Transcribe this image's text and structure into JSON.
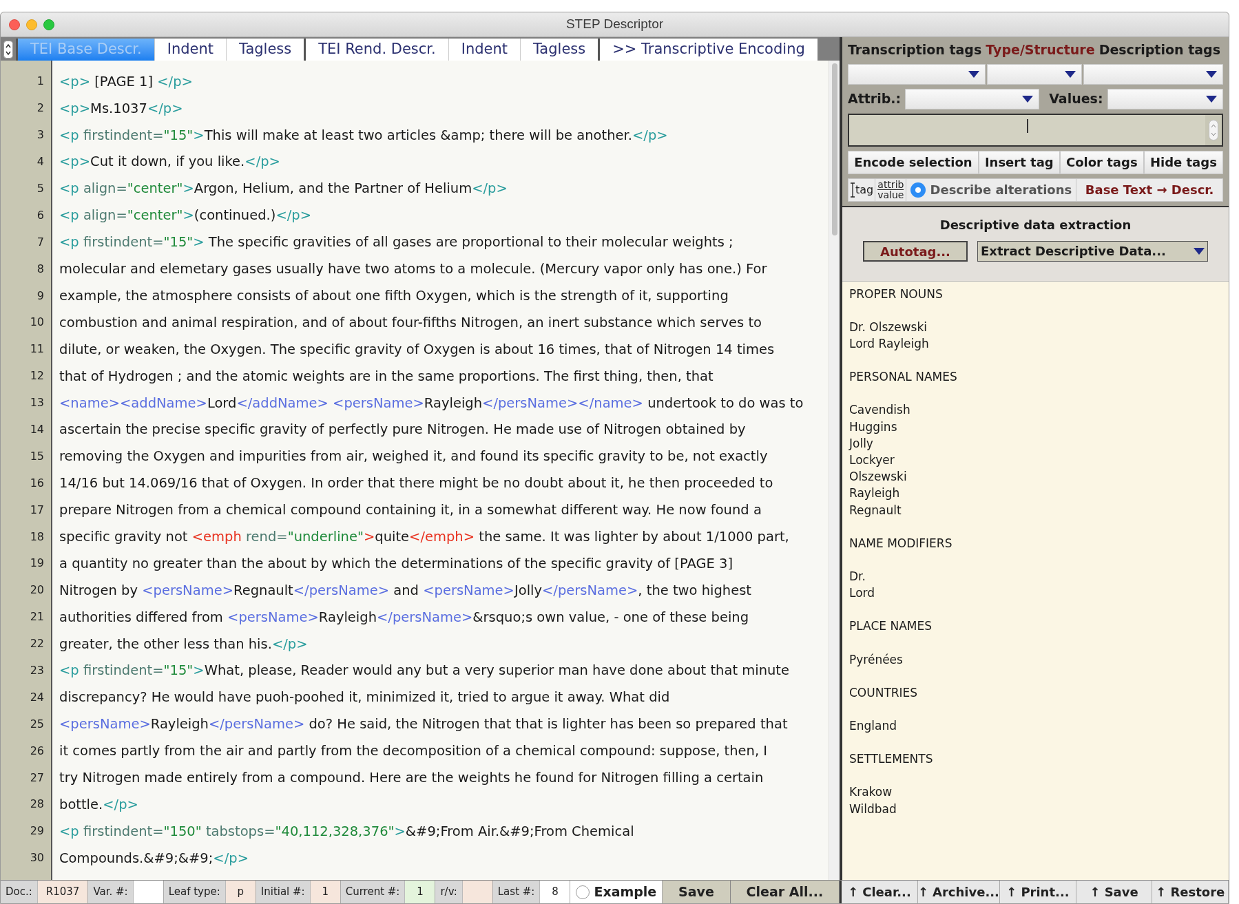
{
  "window": {
    "title": "STEP Descriptor"
  },
  "tabs": [
    {
      "label": "TEI Base Descr.",
      "selected": true,
      "group_start": true
    },
    {
      "label": "Indent",
      "selected": false,
      "group_start": false
    },
    {
      "label": "Tagless",
      "selected": false,
      "group_start": false
    },
    {
      "label": "TEI Rend. Descr.",
      "selected": false,
      "group_start": true
    },
    {
      "label": "Indent",
      "selected": false,
      "group_start": false
    },
    {
      "label": "Tagless",
      "selected": false,
      "group_start": false
    },
    {
      "label": ">> Transcriptive Encoding",
      "selected": false,
      "group_start": true
    }
  ],
  "editor": {
    "lines": [
      {
        "number": "1",
        "segments": [
          {
            "kind": "tag",
            "text": "<p>"
          },
          {
            "kind": "text",
            "text": " [PAGE 1] "
          },
          {
            "kind": "tag",
            "text": "</p>"
          }
        ]
      },
      {
        "number": "2",
        "segments": [
          {
            "kind": "tag",
            "text": "<p>"
          },
          {
            "kind": "text",
            "text": "Ms.1037"
          },
          {
            "kind": "tag",
            "text": "</p>"
          }
        ]
      },
      {
        "number": "3",
        "segments": [
          {
            "kind": "tag",
            "text": "<p "
          },
          {
            "kind": "attr",
            "text": "firstindent="
          },
          {
            "kind": "value",
            "text": "\"15\""
          },
          {
            "kind": "tag",
            "text": ">"
          },
          {
            "kind": "text",
            "text": "This will make at least two articles &amp; there will be another."
          },
          {
            "kind": "tag",
            "text": "</p>"
          }
        ]
      },
      {
        "number": "4",
        "segments": [
          {
            "kind": "tag",
            "text": "<p>"
          },
          {
            "kind": "text",
            "text": "Cut it down, if you like."
          },
          {
            "kind": "tag",
            "text": "</p>"
          }
        ]
      },
      {
        "number": "5",
        "segments": [
          {
            "kind": "tag",
            "text": "<p "
          },
          {
            "kind": "attr",
            "text": "align="
          },
          {
            "kind": "value",
            "text": "\"center\""
          },
          {
            "kind": "tag",
            "text": ">"
          },
          {
            "kind": "text",
            "text": "Argon, Helium, and the Partner of Helium"
          },
          {
            "kind": "tag",
            "text": "</p>"
          }
        ]
      },
      {
        "number": "6",
        "segments": [
          {
            "kind": "tag",
            "text": "<p "
          },
          {
            "kind": "attr",
            "text": "align="
          },
          {
            "kind": "value",
            "text": "\"center\""
          },
          {
            "kind": "tag",
            "text": ">"
          },
          {
            "kind": "text",
            "text": "(continued.)"
          },
          {
            "kind": "tag",
            "text": "</p>"
          }
        ]
      },
      {
        "number": "7",
        "segments": [
          {
            "kind": "tag",
            "text": "<p "
          },
          {
            "kind": "attr",
            "text": "firstindent="
          },
          {
            "kind": "value",
            "text": "\"15\""
          },
          {
            "kind": "tag",
            "text": ">"
          },
          {
            "kind": "text",
            "text": " The specific gravities of all gases are proportional to their molecular weights ;"
          }
        ]
      },
      {
        "number": "8",
        "segments": [
          {
            "kind": "text",
            "text": "molecular and elemetary gases usually have two atoms to a molecule. (Mercury vapor only has one.) For"
          }
        ]
      },
      {
        "number": "9",
        "segments": [
          {
            "kind": "text",
            "text": "example, the atmosphere consists of about one fifth Oxygen, which is the strength of it, supporting"
          }
        ]
      },
      {
        "number": "10",
        "segments": [
          {
            "kind": "text",
            "text": "combustion and animal respiration, and of about four-fifths Nitrogen, an inert substance which serves to"
          }
        ]
      },
      {
        "number": "11",
        "segments": [
          {
            "kind": "text",
            "text": "dilute, or weaken, the Oxygen. The specific gravity of Oxygen is about 16 times, that of Nitrogen 14 times"
          }
        ]
      },
      {
        "number": "12",
        "segments": [
          {
            "kind": "text",
            "text": "that of Hydrogen ; and the atomic weights are in the same proportions. The first thing, then, that"
          }
        ]
      },
      {
        "number": "13",
        "segments": [
          {
            "kind": "name",
            "text": "<name><addName>"
          },
          {
            "kind": "text",
            "text": "Lord"
          },
          {
            "kind": "name",
            "text": "</addName> <persName>"
          },
          {
            "kind": "text",
            "text": "Rayleigh"
          },
          {
            "kind": "name",
            "text": "</persName></name>"
          },
          {
            "kind": "text",
            "text": " undertook to do was to"
          }
        ]
      },
      {
        "number": "14",
        "segments": [
          {
            "kind": "text",
            "text": "ascertain the precise specific gravity of perfectly pure Nitrogen. He made use of Nitrogen obtained by"
          }
        ]
      },
      {
        "number": "15",
        "segments": [
          {
            "kind": "text",
            "text": "removing the Oxygen and impurities from air, weighed it, and found its specific gravity to be, not exactly"
          }
        ]
      },
      {
        "number": "16",
        "segments": [
          {
            "kind": "text",
            "text": "14/16 but 14.069/16 that of Oxygen. In order that there might be no doubt about it, he then proceeded to"
          }
        ]
      },
      {
        "number": "17",
        "segments": [
          {
            "kind": "text",
            "text": "prepare Nitrogen from a chemical compound containing it, in a somewhat different way. He now found a"
          }
        ]
      },
      {
        "number": "18",
        "segments": [
          {
            "kind": "text",
            "text": "specific gravity not "
          },
          {
            "kind": "emph",
            "text": "<emph "
          },
          {
            "kind": "attr",
            "text": "rend="
          },
          {
            "kind": "value",
            "text": "\"underline\""
          },
          {
            "kind": "emph",
            "text": ">"
          },
          {
            "kind": "text",
            "text": "quite"
          },
          {
            "kind": "emph",
            "text": "</emph>"
          },
          {
            "kind": "text",
            "text": " the same. It was lighter by about 1/1000 part,"
          }
        ]
      },
      {
        "number": "19",
        "segments": [
          {
            "kind": "text",
            "text": "a quantity no greater than the about by which the determinations of the specific gravity of [PAGE 3]"
          }
        ]
      },
      {
        "number": "20",
        "segments": [
          {
            "kind": "text",
            "text": "Nitrogen by "
          },
          {
            "kind": "name",
            "text": "<persName>"
          },
          {
            "kind": "text",
            "text": "Regnault"
          },
          {
            "kind": "name",
            "text": "</persName>"
          },
          {
            "kind": "text",
            "text": " and "
          },
          {
            "kind": "name",
            "text": "<persName>"
          },
          {
            "kind": "text",
            "text": "Jolly"
          },
          {
            "kind": "name",
            "text": "</persName>"
          },
          {
            "kind": "text",
            "text": ", the two highest"
          }
        ]
      },
      {
        "number": "21",
        "segments": [
          {
            "kind": "text",
            "text": "authorities differed from "
          },
          {
            "kind": "name",
            "text": "<persName>"
          },
          {
            "kind": "text",
            "text": "Rayleigh"
          },
          {
            "kind": "name",
            "text": "</persName>"
          },
          {
            "kind": "text",
            "text": "&rsquo;s own value, - one of these being"
          }
        ]
      },
      {
        "number": "22",
        "segments": [
          {
            "kind": "text",
            "text": "greater, the other less than his."
          },
          {
            "kind": "tag",
            "text": "</p>"
          }
        ]
      },
      {
        "number": "23",
        "segments": [
          {
            "kind": "tag",
            "text": "<p "
          },
          {
            "kind": "attr",
            "text": "firstindent="
          },
          {
            "kind": "value",
            "text": "\"15\""
          },
          {
            "kind": "tag",
            "text": ">"
          },
          {
            "kind": "text",
            "text": "What, please, Reader would any but a very superior man have done about that minute"
          }
        ]
      },
      {
        "number": "24",
        "segments": [
          {
            "kind": "text",
            "text": "discrepancy? He would have puoh-poohed it, minimized it, tried to argue it away. What did"
          }
        ]
      },
      {
        "number": "25",
        "segments": [
          {
            "kind": "name",
            "text": "<persName>"
          },
          {
            "kind": "text",
            "text": "Rayleigh"
          },
          {
            "kind": "name",
            "text": "</persName>"
          },
          {
            "kind": "text",
            "text": " do? He said, the Nitrogen that that is lighter has been so prepared that"
          }
        ]
      },
      {
        "number": "26",
        "segments": [
          {
            "kind": "text",
            "text": "it comes partly from the air and partly from the decomposition of a chemical compound: suppose, then, I"
          }
        ]
      },
      {
        "number": "27",
        "segments": [
          {
            "kind": "text",
            "text": "try Nitrogen made entirely from a compound. Here are the weights he found for Nitrogen filling a certain"
          }
        ]
      },
      {
        "number": "28",
        "segments": [
          {
            "kind": "text",
            "text": "bottle."
          },
          {
            "kind": "tag",
            "text": "</p>"
          }
        ]
      },
      {
        "number": "29",
        "segments": [
          {
            "kind": "tag",
            "text": "<p "
          },
          {
            "kind": "attr",
            "text": "firstindent="
          },
          {
            "kind": "value",
            "text": "\"150\""
          },
          {
            "kind": "attr",
            "text": " tabstops="
          },
          {
            "kind": "value",
            "text": "\"40,112,328,376\""
          },
          {
            "kind": "tag",
            "text": ">"
          },
          {
            "kind": "text",
            "text": "&#9;From Air.&#9;From Chemical"
          }
        ]
      },
      {
        "number": "30",
        "segments": [
          {
            "kind": "text",
            "text": "Compounds.&#9;&#9;"
          },
          {
            "kind": "tag",
            "text": "</p>"
          }
        ]
      }
    ]
  },
  "tag_panel": {
    "headers": [
      {
        "kind": "plain",
        "text": "Transcription tags"
      },
      {
        "kind": "accent",
        "text": "Type/Structure"
      },
      {
        "kind": "plain",
        "text": "Description tags"
      }
    ],
    "attrib_label": "Attrib.:",
    "values_label": "Values:",
    "buttons": [
      "Encode selection",
      "Insert tag",
      "Color tags",
      "Hide tags"
    ],
    "tag_icon_label": "tag",
    "attrib_icon_top": "attrib",
    "attrib_icon_bottom": "value",
    "describe_alterations": {
      "label": "Describe alterations",
      "selected": true
    },
    "base_text_button": "Base Text → Descr."
  },
  "extraction": {
    "title": "Descriptive data extraction",
    "autotag_button": "Autotag...",
    "dropdown": "Extract Descriptive Data...",
    "sections": [
      {
        "heading": "PROPER NOUNS",
        "items": [
          "Dr. Olszewski",
          "Lord Rayleigh"
        ]
      },
      {
        "heading": "PERSONAL NAMES",
        "items": [
          "Cavendish",
          "Huggins",
          "Jolly",
          "Lockyer",
          "Olszewski",
          "Rayleigh",
          "Regnault"
        ]
      },
      {
        "heading": "NAME MODIFIERS",
        "items": [
          "Dr.",
          "Lord"
        ]
      },
      {
        "heading": "PLACE NAMES",
        "items": [
          "Pyrénées"
        ]
      },
      {
        "heading": "COUNTRIES",
        "items": [
          "England"
        ]
      },
      {
        "heading": "SETTLEMENTS",
        "items": [
          "Krakow",
          "Wildbad"
        ]
      }
    ]
  },
  "status_bar": {
    "fields": [
      {
        "label": "Doc.:",
        "value": "R1037",
        "color": "#f6e6dc"
      },
      {
        "label": "Var. #:",
        "color": "#ffffff"
      },
      {
        "label": "Leaf type:",
        "value": "p",
        "color": "#f6e6dc"
      },
      {
        "label": "Initial #:",
        "value": "1",
        "color": "#f6e6dc"
      },
      {
        "label": "Current #:",
        "value": "1",
        "color": "#e4f4dc"
      },
      {
        "label": "r/v:",
        "color": "#f6e6dc"
      },
      {
        "label": "Last #:",
        "value": "8",
        "color": "#ffffff"
      }
    ],
    "example": {
      "label": "Example",
      "selected": false
    },
    "buttons": [
      "Save",
      "Clear All..."
    ],
    "right_buttons": [
      "↑ Clear...",
      "↑ Archive...",
      "↑ Print...",
      "↑ Save",
      "↑ Restore"
    ]
  }
}
